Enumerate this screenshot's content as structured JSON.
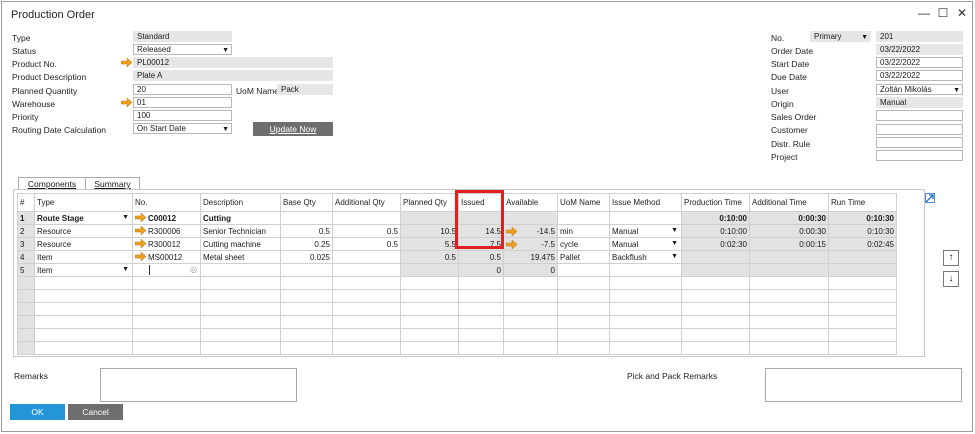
{
  "window": {
    "title": "Production Order",
    "minimize": "—",
    "maximize": "☐",
    "close": "✕"
  },
  "left_form": {
    "type_label": "Type",
    "type_value": "Standard",
    "status_label": "Status",
    "status_value": "Released",
    "product_no_label": "Product No.",
    "product_no_value": "PL00012",
    "product_desc_label": "Product Description",
    "product_desc_value": "Plate A",
    "planned_qty_label": "Planned Quantity",
    "planned_qty_value": "20",
    "uom_label": "UoM Name",
    "uom_value": "Pack",
    "warehouse_label": "Warehouse",
    "warehouse_value": "01",
    "priority_label": "Priority",
    "priority_value": "100",
    "routing_label": "Routing Date Calculation",
    "routing_value": "On Start Date",
    "update_button": "Update Now"
  },
  "right_form": {
    "no_label": "No.",
    "series_value": "Primary",
    "no_value": "201",
    "order_date_label": "Order Date",
    "order_date_value": "03/22/2022",
    "start_date_label": "Start Date",
    "start_date_value": "03/22/2022",
    "due_date_label": "Due Date",
    "due_date_value": "03/22/2022",
    "user_label": "User",
    "user_value": "Zoltán Mikolás",
    "origin_label": "Origin",
    "origin_value": "Manual",
    "sales_order_label": "Sales Order",
    "customer_label": "Customer",
    "distr_rule_label": "Distr. Rule",
    "project_label": "Project"
  },
  "tabs": [
    {
      "label": "Components"
    },
    {
      "label": "Summary"
    }
  ],
  "grid": {
    "columns": [
      "#",
      "Type",
      "No.",
      "Description",
      "Base Qty",
      "Additional Qty",
      "Planned Qty",
      "Issued",
      "Available",
      "UoM Name",
      "Issue Method",
      "Production Time",
      "Additional Time",
      "Run Time"
    ],
    "rows": [
      [
        "1",
        "Route Stage",
        "C00012",
        "Cutting",
        "",
        "",
        "",
        "",
        "",
        "",
        "",
        "0:10:00",
        "0:00:30",
        "0:10:30"
      ],
      [
        "2",
        "Resource",
        "R300006",
        "Senior Technician",
        "0.5",
        "0.5",
        "10.5",
        "14.5",
        "-14.5",
        "min",
        "Manual",
        "0:10:00",
        "0:00:30",
        "0:10:30"
      ],
      [
        "3",
        "Resource",
        "R300012",
        "Cutting machine",
        "0.25",
        "0.5",
        "5.5",
        "7.5",
        "-7.5",
        "cycle",
        "Manual",
        "0:02:30",
        "0:00:15",
        "0:02:45"
      ],
      [
        "4",
        "Item",
        "MS00012",
        "Metal sheet",
        "0.025",
        "",
        "0.5",
        "0.5",
        "19.475",
        "Pallet",
        "Backflush",
        "",
        "",
        ""
      ],
      [
        "5",
        "Item",
        "",
        "",
        "",
        "",
        "",
        "0",
        "0",
        "",
        "",
        "",
        "",
        ""
      ]
    ]
  },
  "remarks_label": "Remarks",
  "pick_pack_label": "Pick and Pack Remarks",
  "buttons": {
    "ok": "OK",
    "cancel": "Cancel"
  },
  "colors": {
    "accent_blue": "#2495d8",
    "arrow_orange": "#f0a020",
    "highlight_red": "#e02020",
    "button_gray": "#6e6e6e"
  }
}
